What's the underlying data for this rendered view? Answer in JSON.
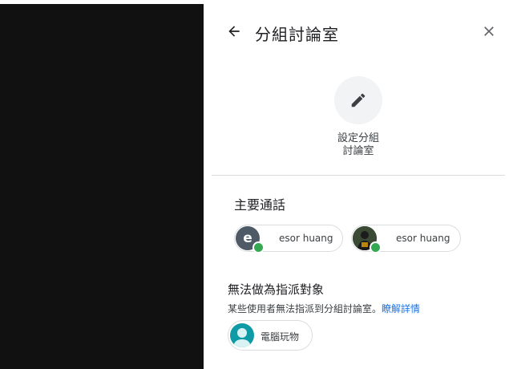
{
  "panel": {
    "title": "分組討論室",
    "back_icon": "arrow-left-icon",
    "close_icon": "close-icon"
  },
  "setup": {
    "icon": "pencil-icon",
    "label_line1": "設定分組",
    "label_line2": "討論室"
  },
  "main_call": {
    "heading": "主要通話",
    "participants": [
      {
        "avatar_letter": "e",
        "name": "esor huang",
        "status": "online"
      },
      {
        "avatar_letter": "",
        "name": "esor huang",
        "status": "online"
      }
    ]
  },
  "unassignable": {
    "heading": "無法做為指派對象",
    "description": "某些使用者無法指派到分組討論室。",
    "learn_more": "瞭解詳情",
    "participants": [
      {
        "name": "電腦玩物"
      }
    ]
  },
  "colors": {
    "accent": "#1a73e8",
    "online": "#34a853",
    "left_background": "#111111"
  }
}
